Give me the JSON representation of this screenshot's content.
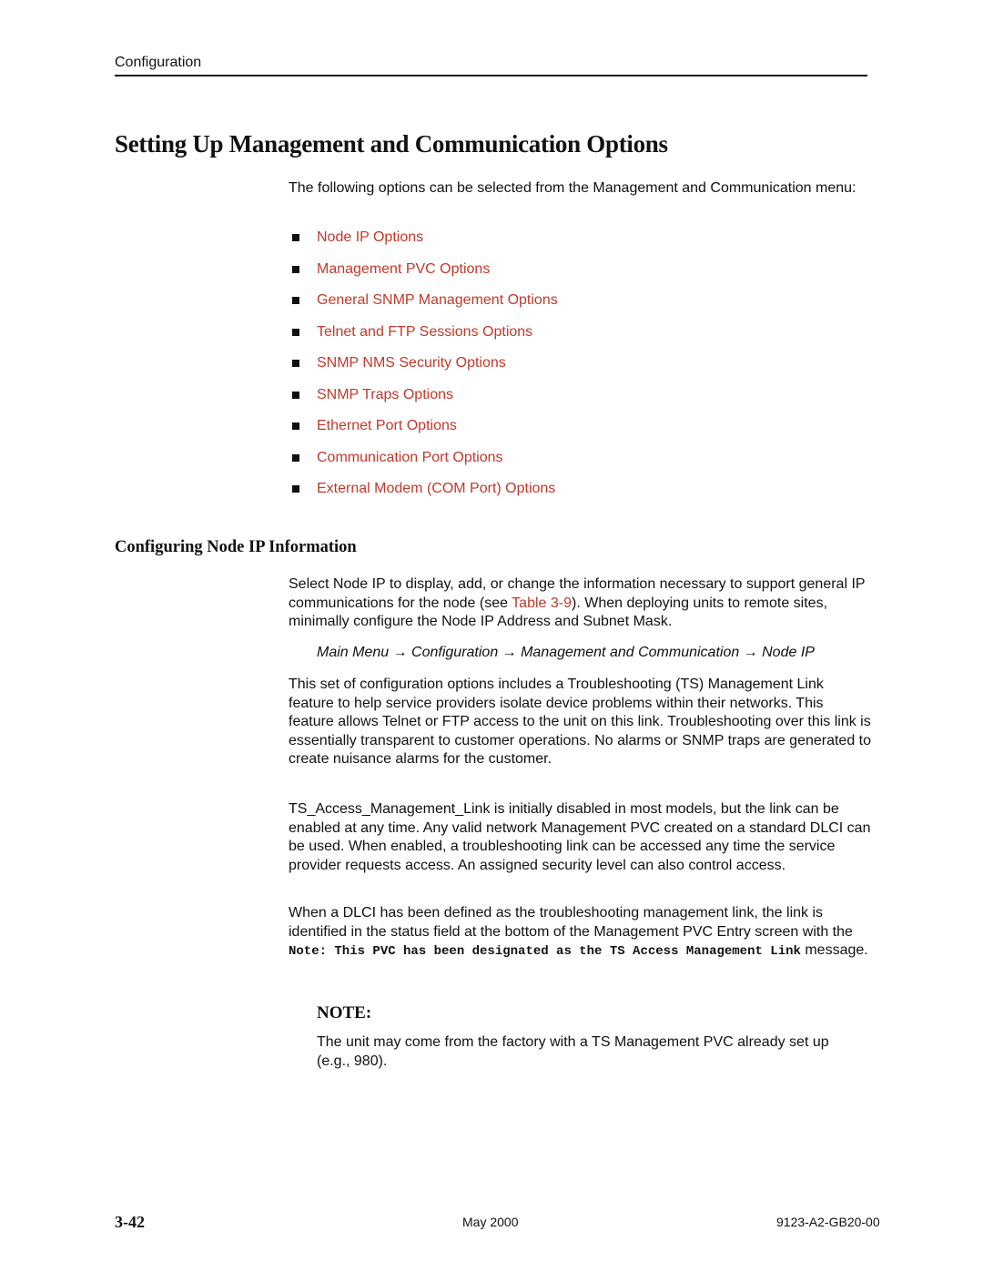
{
  "header": {
    "running_head": "Configuration"
  },
  "section": {
    "title": "Setting Up Management and Communication Options",
    "intro": "The following options can be selected from the Management and Communication menu:",
    "options": [
      {
        "label": "Node IP Options"
      },
      {
        "label": "Management PVC Options"
      },
      {
        "label": "General SNMP Management Options"
      },
      {
        "label": "Telnet and FTP Sessions Options"
      },
      {
        "label": "SNMP NMS Security Options"
      },
      {
        "label": "SNMP Traps Options"
      },
      {
        "label": "Ethernet Port Options"
      },
      {
        "label": "Communication Port Options"
      },
      {
        "label": "External Modem (COM Port) Options"
      }
    ]
  },
  "subsection": {
    "title": "Configuring Node IP Information",
    "para1_before": "Select Node IP to display, add, or change the information necessary to support general IP communications for the node (see ",
    "para1_link": "Table 3-9",
    "para1_after": "). When deploying units to remote sites, minimally configure the Node IP Address and Subnet Mask.",
    "menu_path": "Main Menu → Configuration → Management and Communication → Node IP",
    "para2": "This set of configuration options includes a Troubleshooting (TS) Management Link feature to help service providers isolate device problems within their networks. This feature allows Telnet or FTP access to the unit on this link. Troubleshooting over this link is essentially transparent to customer operations. No alarms or SNMP traps are generated to create nuisance alarms for the customer.",
    "para3": "TS_Access_Management_Link is initially disabled in most models, but the link can be enabled at any time. Any valid network Management PVC created on a standard DLCI can be used. When enabled, a troubleshooting link can be accessed any time the service provider requests access. An assigned security level can also control access.",
    "para4_before": "When a DLCI has been defined as the troubleshooting management link, the link is identified in the status field at the bottom of the Management PVC Entry screen with the ",
    "para4_code": "Note: This PVC has been designated as the TS Access Management Link",
    "para4_after": " message."
  },
  "note": {
    "title": "NOTE:",
    "body": "The unit may come from the factory with a TS Management PVC already set up (e.g., 980)."
  },
  "footer": {
    "page_number": "3-42",
    "date": "May 2000",
    "doc_number": "9123-A2-GB20-00"
  },
  "colors": {
    "link": "#c0392b",
    "text": "#111111"
  }
}
